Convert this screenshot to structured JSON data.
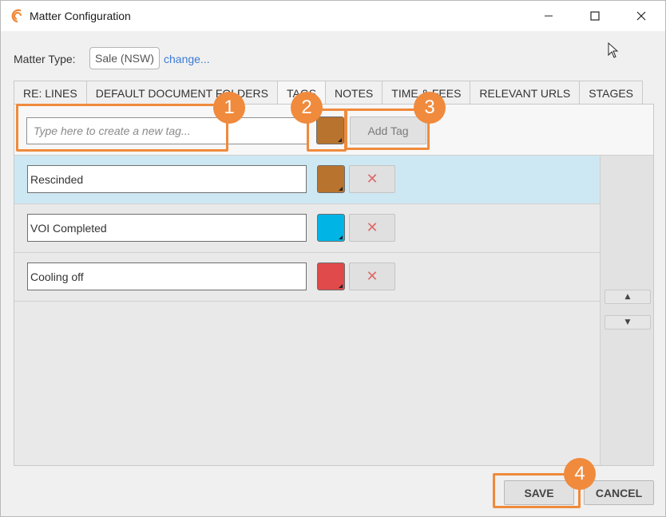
{
  "window": {
    "title": "Matter Configuration",
    "controls": {
      "minimize_icon": "minimize-icon",
      "maximize_icon": "maximize-icon",
      "close_icon": "close-icon"
    }
  },
  "matter": {
    "label": "Matter Type:",
    "value": "Sale (NSW)",
    "change_link": "change..."
  },
  "tabs": [
    {
      "label": "RE: LINES",
      "active": false
    },
    {
      "label": "DEFAULT DOCUMENT FOLDERS",
      "active": false
    },
    {
      "label": "TAGS",
      "active": true
    },
    {
      "label": "NOTES",
      "active": false
    },
    {
      "label": "TIME & FEES",
      "active": false
    },
    {
      "label": "RELEVANT URLS",
      "active": false
    },
    {
      "label": "STAGES",
      "active": false
    }
  ],
  "new_tag": {
    "placeholder": "Type here to create a new tag...",
    "color": "#b8732e",
    "add_label": "Add Tag"
  },
  "tags": [
    {
      "name": "Rescinded",
      "color": "#b8732e",
      "selected": true,
      "remove_symbol": "✕"
    },
    {
      "name": "VOI Completed",
      "color": "#00b4e6",
      "selected": false,
      "remove_symbol": "✕"
    },
    {
      "name": "Cooling off",
      "color": "#e04a4a",
      "selected": false,
      "remove_symbol": "✕"
    }
  ],
  "reorder": {
    "up_symbol": "▲",
    "down_symbol": "▼"
  },
  "footer": {
    "save_label": "SAVE",
    "cancel_label": "CANCEL"
  },
  "annotations": {
    "color": "#f08a3c",
    "badges": [
      "1",
      "2",
      "3",
      "4"
    ]
  }
}
